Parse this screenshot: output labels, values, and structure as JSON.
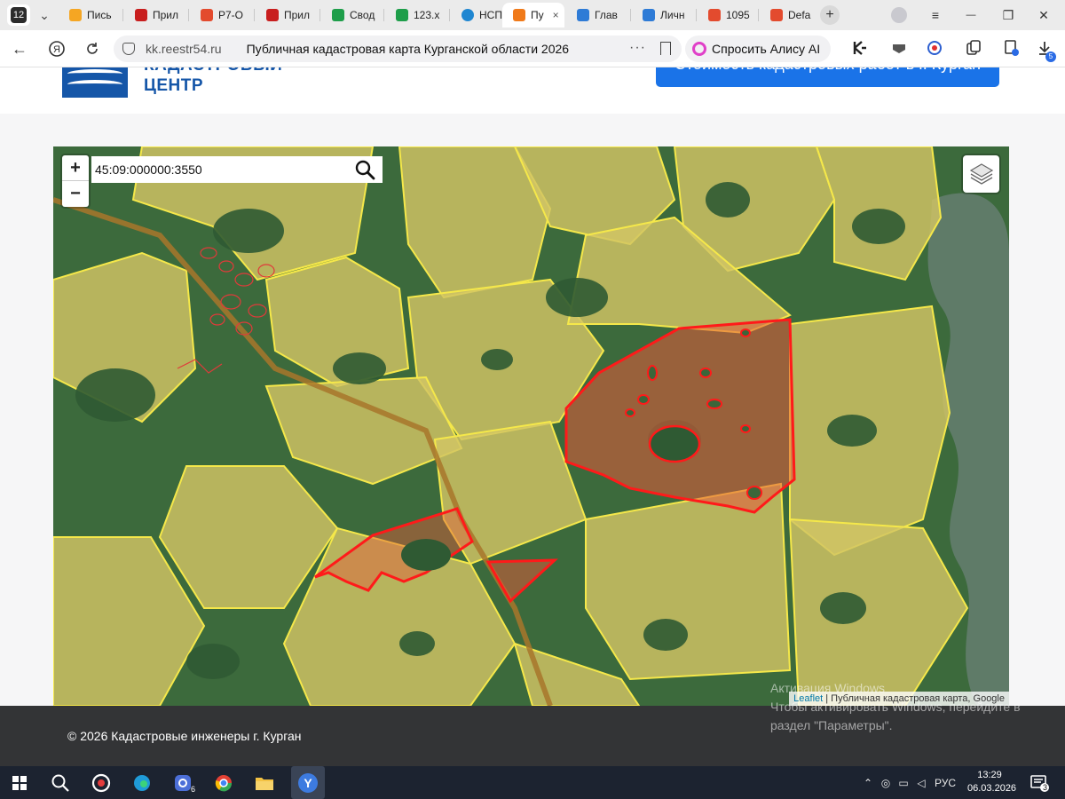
{
  "browser": {
    "tab_count": "12",
    "tabs": [
      {
        "label": "Пись",
        "color": "#f5a623"
      },
      {
        "label": "Прил",
        "color": "#c81e1e"
      },
      {
        "label": "Р7-О",
        "color": "#e34b2e"
      },
      {
        "label": "Прил",
        "color": "#c81e1e"
      },
      {
        "label": "Свод",
        "color": "#1e9e4a"
      },
      {
        "label": "123.x",
        "color": "#1e9e4a"
      },
      {
        "label": "НСП(",
        "color": "#1f86d1"
      },
      {
        "label": "Пу",
        "color": "#f07a1a"
      },
      {
        "label": "Глав",
        "color": "#2e7bd6"
      },
      {
        "label": "Личн",
        "color": "#2e7bd6"
      },
      {
        "label": "1095",
        "color": "#e34b2e"
      },
      {
        "label": "Defa",
        "color": "#e34b2e"
      }
    ],
    "active_tab_close": "×",
    "new_tab": "+",
    "window_controls": {
      "menu": "≡",
      "minimize": "—",
      "restore": "❐",
      "close": "✕"
    }
  },
  "addressbar": {
    "domain": "kk.reestr54.ru",
    "page_title": "Публичная кадастровая карта Курганской области 2026",
    "more": "···",
    "alice_label": "Спросить Алису AI",
    "downloads_badge": "5"
  },
  "site": {
    "logo_line1": "КАДАСТРОВЫЙ",
    "logo_line2": "ЦЕНТР",
    "cta_label": "Стоимость кадастровых работ в г. Курган",
    "brand_color": "#1556a8",
    "cta_color": "#1a73e8"
  },
  "map": {
    "search_value": "45:09:000000:3550",
    "zoom_in": "+",
    "zoom_out": "−",
    "attribution_link": "Leaflet",
    "attribution_text": " | Публичная кадастровая карта, Google",
    "parcel_fill": "#f0dc60",
    "parcel_border": "#f5e84a",
    "selected_color": "#ff1a1a"
  },
  "watermark": {
    "line1": "Активация Windows",
    "line2": "Чтобы активировать Windows, перейдите в",
    "line3": "раздел \"Параметры\"."
  },
  "footer": {
    "copyright": "© 2026 Кадастровые инженеры г. Курган"
  },
  "taskbar": {
    "language": "РУС",
    "time": "13:29",
    "date": "06.03.2026",
    "notifications": "3",
    "badge_app": "6"
  }
}
